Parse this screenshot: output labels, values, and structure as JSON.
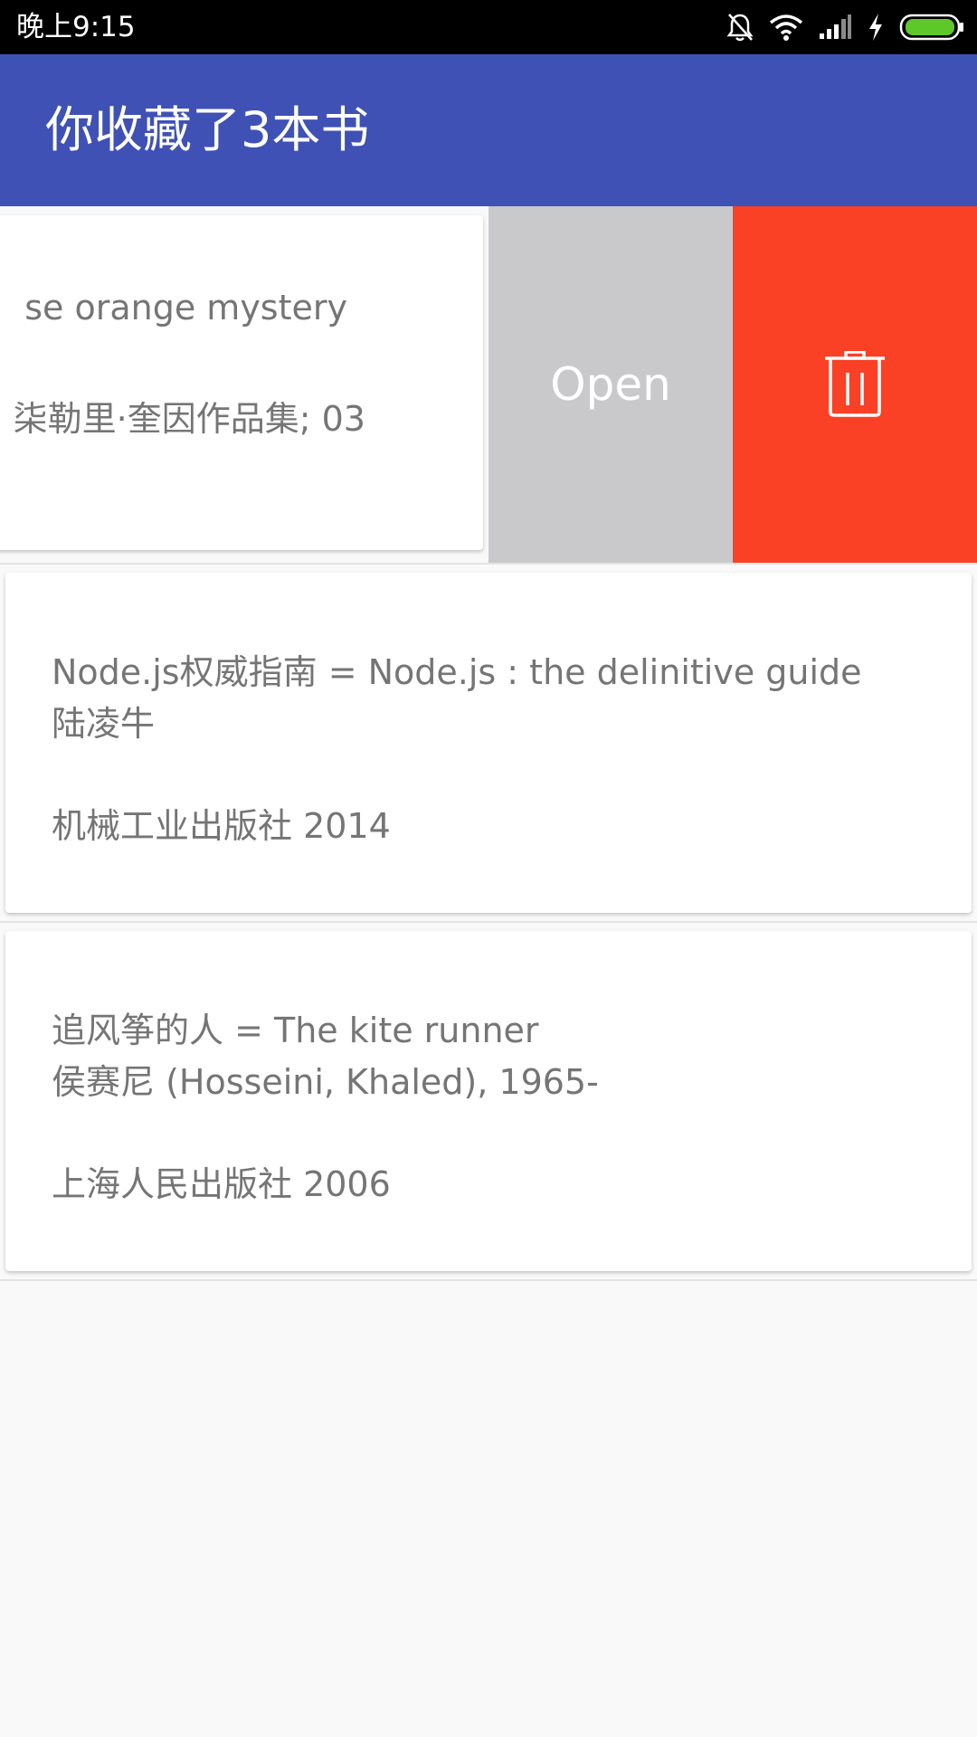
{
  "status_bar": {
    "time": "晚上9:15",
    "icons": [
      "mute-bell-icon",
      "wifi-icon",
      "cell-signal-icon",
      "charging-icon",
      "battery-icon"
    ]
  },
  "app_bar": {
    "title": "你收藏了3本书",
    "color": "#3f51b5"
  },
  "swiped_item": {
    "line1": "se orange mystery",
    "line2": "柒勒里·奎因作品集; 03",
    "open_label": "Open",
    "open_color": "#c9c9cc",
    "delete_icon": "trash-icon",
    "delete_color": "#fa4025"
  },
  "books": [
    {
      "title": "Node.js权威指南 = Node.js : the delinitive guide",
      "author": "陆凌牛",
      "publisher": "机械工业出版社 2014"
    },
    {
      "title": "追风筝的人 = The kite runner",
      "author": "侯赛尼 (Hosseini, Khaled), 1965-",
      "publisher": "上海人民出版社 2006"
    }
  ]
}
